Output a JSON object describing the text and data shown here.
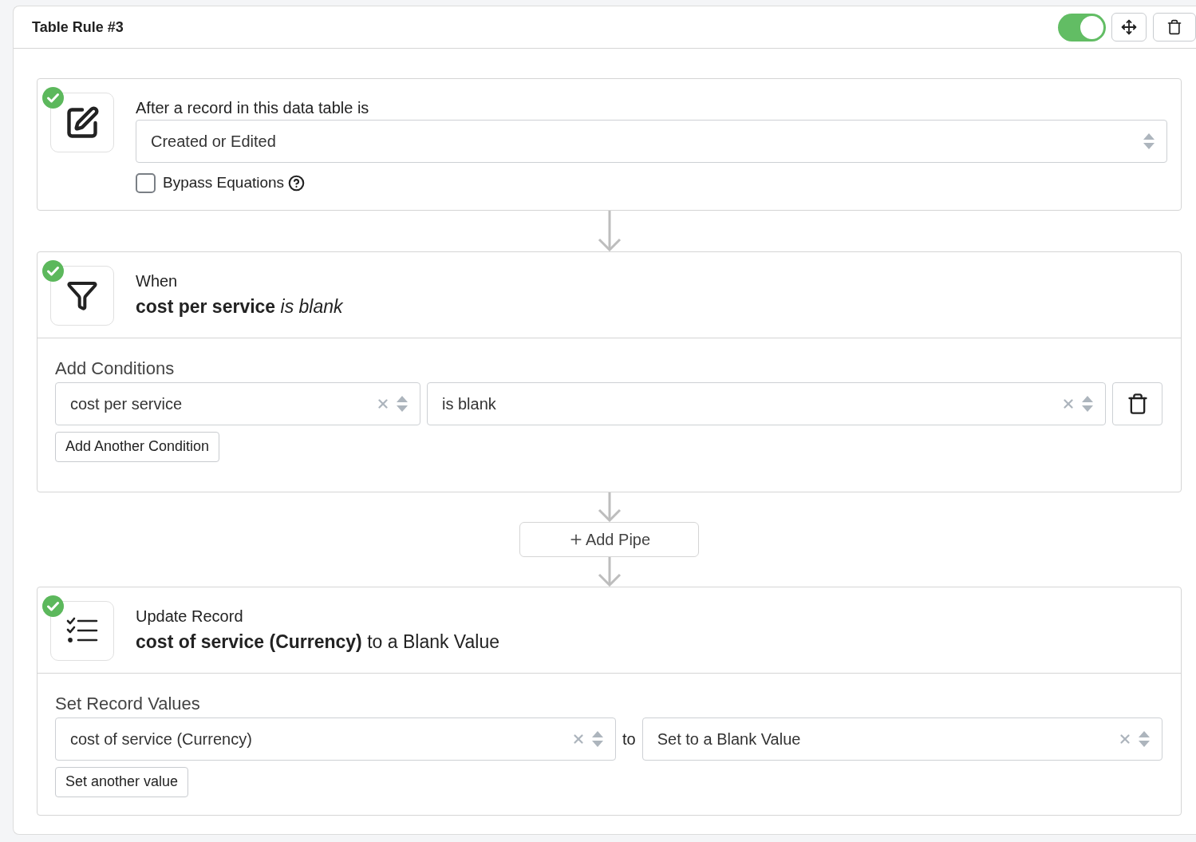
{
  "header": {
    "title": "Table Rule #3",
    "enabled": true
  },
  "flow": [
    {
      "kind": "trigger",
      "complete": true,
      "label": "After a record in this data table is",
      "select": "Created or Edited",
      "option": {
        "label": "Bypass Equations",
        "checked": false
      }
    },
    {
      "kind": "condition",
      "complete": true,
      "label": "When",
      "summary": "**cost per service** *is blank*",
      "section_title": "Add Conditions",
      "rows": [
        {
          "field": "cost per service",
          "operator": "is blank"
        }
      ],
      "add_button": "Add Another Condition"
    },
    {
      "kind": "add_pipe",
      "label": "Add Pipe"
    },
    {
      "kind": "action",
      "complete": true,
      "label": "Update Record",
      "summary": "**cost of service (Currency)** to a Blank Value",
      "section_title": "Set Record Values",
      "rows": [
        {
          "field": "cost of service (Currency)",
          "joiner": "to",
          "value": "Set to a Blank Value"
        }
      ],
      "add_button": "Set another value"
    }
  ]
}
